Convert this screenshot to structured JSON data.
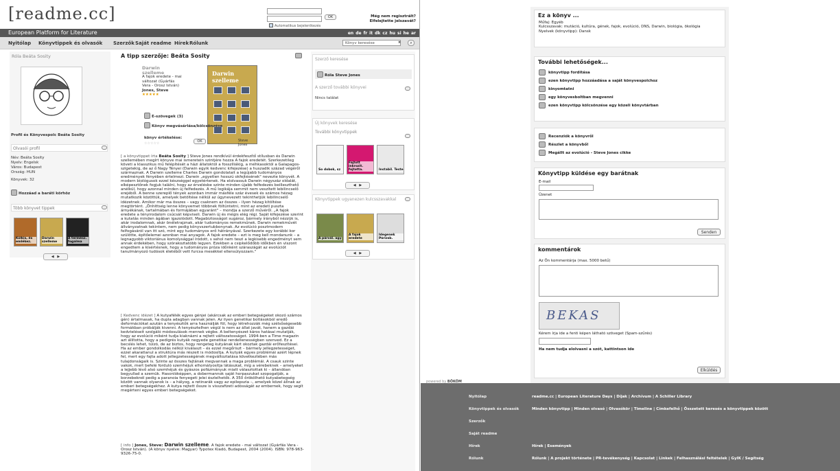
{
  "header": {
    "logo": "[readme.cc]",
    "tagline": "European Platform for Literature",
    "ok": "OK",
    "autologin": "Automatikus bejelentkezés",
    "register": "Még nem regisztrált?",
    "forgot": "Elfelejtette jelszavát?",
    "languages": [
      "en",
      "de",
      "fr",
      "it",
      "dk",
      "cz",
      "hu",
      "si",
      "he",
      "ar"
    ]
  },
  "nav": {
    "items": [
      "Nyitólap",
      "Könyvtippek és olvasók",
      "Szerzők",
      "Saját readme",
      "Hírek",
      "Rólunk"
    ],
    "search_placeholder": "Könyv keresése"
  },
  "left_col": {
    "about": "Róla Beáta Sosity",
    "profile_link": "Profil és Könyvespolc Beáta Sosity",
    "reader_profile": "Olvasói profil",
    "info": [
      "Név: Beáta Sosity",
      "Nyelv: Engelsk",
      "Város: Budapest",
      "Ország: HUN"
    ],
    "books_count": "Könyvek: 32",
    "add_friend": "Hozzáad a baráti körhöz",
    "more_tips": "Több könyvet tippek",
    "thumbs": [
      "Kölkis, és emlékez.",
      "Darwin szelleme",
      "A termész. fogalma"
    ]
  },
  "main": {
    "title": "A tipp szerzője: Beáta Sosity",
    "book_title": "Darwin szelleme",
    "book_sub": "A fajok eredete - mai változat (Gyárfás Vera - Orosz István)",
    "book_author": "Jones, Steve",
    "stars": "★★★★★",
    "ebooks": "E-szövegek (3)",
    "compare": "Könyv megvásárlása/kölcsönzése",
    "rating_label": "könyv értékelése:",
    "rating_stars": "☆☆☆☆☆",
    "cover_title": "Darwin szelleme",
    "cover_author": "Steve Jones",
    "para1_tag": "[ a könyvtippet írta ",
    "para1_author": "Beáta Sosity",
    "para1_rest": " ] Steve Jones rendkívül érdekfeszítő stílusban és Darwin szellemében megírt könyve mai ismeretein szintjére hozza A fajok eredetét. Szerkezetileg követi a klasszikus mű felépítését a házi állatoktól a fosszíliákig, a méhkasoktól a Galapagos-szigetekig, de az ő Nagy Tényei (Darwin egyik kedvenc kifejezése) a huszadik század végéről származnak. A Darwin szelleme Charles Darwin gondolatait a legújabb tudományos eredmények fényében értelmezi. Darwin „egyetlen hosszú okfejtésének\" nevezte könyvét. A modern biológusok ezzel készséggel egyetértenek. Ha elolvassuk Darwin négyszáz oldalát, elképesztőnek fogjuk találni, hogy az érvelésbe szinte minden újabb felfedezés beilleszthető anélkül, hogy azonnal minden új felfedezés. A mű logikája semmit nem veszített lebilincselő erejéből. A benne szereplő tények azonban immár másféle száz évesek és számos hézag mutatkozik közöttük, amelyek betöltése nélkül az úgynevezett tekinthetjük lebilincselő idézetnek. Amikor már ma összes – vagy csaknem az összes – ilyen hézag kitöltése megtörtént. „Önhittség lenne könyvemet többnek föltüntetni, mint az eredeti puszta árnyékának, tartalmában és formájában egyaránt\" – mondja a szerző művéről. „A fajok eredete a tényirodalom csúcsát képviseli. Darwin új és mégis elég régi. Saját kifejezése szerint a kutatás minden ágában igazolódott. Magabiztosságot sugároz, bármely irányból nézzük is, akár irodalomnak, akár önéletrajznak, akár tudományos remekműnek. Darwin remekművét állványzatnak tekintem, nem pedig könyvszertubbonynak. Az evolúció posztmodern felfogásáról van itt szó, mint egy tudományos erő hátrányával. Szerkezete egy korábbi kor szülötte, építőelemei azonban mai anyagok. A fajok eredete – ezt is meg kell mondanunk – a legnagyobb viktoriánus komolysággal íródott, s sehol nem teszi a legkisebb engedményt sem annak érdekében, hogy szórakoztatóbb legyen. Ezekben a csipkelődőbb időkben én viszont engedtem a kísértésnek, hogy a tudományos próza időnként száraszágát az evolúciót tanulmányozó tudósok életéből vett furcsa mesékkel ellensúlyozzam.\"",
    "para2_tag": "[ Kedvenc idézet ]",
    "para2_rest": " A kutyafélék egyes génjei (akárcsak az emberi betegségeket okozó számos gén) ártalmasak, ha dupla adagban vannak jelen. Az ilyen genetikai botlásokból eredő deformációkat azután a tenyésztők arra használják föl, hogy létrehozzák még szélsőségesebb formákban próbálják kivenni. A tenyésztelhen végül is nem az állat javát, hanem a gazdái kedvteléseit szolgáló módosulások mennek végbe. A beltenyészet káros hatásai mutatják, hogy az evolúció miként tudja kiaknázni a rejtett változatosságot. 1994-ben a Time magazin azt állította, hogy a pedigrés kutyák negyede genetikai rendellenességben szenved. Ez a becslés lehet, túlzó, de az biztos, hogy rengeteg kutyának kárt okoztak gazdái erőfeszítései. Ha az ember gondolkodás nélkül kiválaszt – és ezzel megőriszt – bármely jellegzetességet, ezzel akaratlanul a struktúra más részeit is módosítja. A kutyák egyes problémái azért lépnek fel, mert egy fajta adott jellegzetességének megváltoztatása következtében más tulajdonságaik is. Szinte az összes fajtának megvannak a maga problémái. A csauk szinte vakok, mert befelé forduló szemhéjuk elhomályosítja látásukat, míg a vérebeknek – amelyeket a lejjebb lévő alsó szemhéjuk és gyászos pofázmányuk miatt választottak ki – állandóan begyullad a szemük. Hasonlóképpen, a dobermannok saját horpaszukat szopogatják, a borzebeknél pedig a paranoia fenyegeti jelei észlelhetők. A 350 őrökölhető kutyabetegség között vannak olyanok is – a hályog, a retinarák vagy az epilepszia –, amelyek közel állnak az emberi betegségekhez. A kutya rejtett őssze is visszafizeti adósságát az embernek, hogy segít megérteni egyes emberi betegségeket.",
    "para3_tag": "[ info ] ",
    "para3_bold1": "Jones, Steve: ",
    "para3_bold2": "Darwin szelleme",
    "para3_rest": ". A fajok eredete - mai változat (Gyárfás Vera - Orosz István). (A könyv nyelve: Magyar) Typotex Kiadó, Budapest, 2004 (2004). ISBN: 978-963-9326-75-0."
  },
  "right_col": {
    "author_search": "Szerző keresése",
    "about_author": "Róla Steve Jones",
    "more_books": "A szerző további könyvei",
    "no_result": "Nincs találat",
    "new_books": "Új könyvek keresése",
    "more_tips": "További könyvtippek",
    "tips1": [
      "So dobok, sz",
      "Fajtott inkrozit. fojtotta.",
      "Instabil. Teste"
    ],
    "keyword_tips": "Könyvtippek ugyanezen kulcsszavakkal",
    "tips2": [
      "A párvál. agy",
      "A fajok eredete",
      "Idegenek Párizsb."
    ]
  },
  "about_book": {
    "title": "Ez a könyv ...",
    "genre": "Műfaj: Egyéb",
    "keywords": "Kulcsszavak: mutáció, kultúra, gének, fajok, evolúció, DNS, Darwin, biológia, ökológia",
    "language": "Nyelvek (könyvtipp): Dansk"
  },
  "more_options": {
    "title": "További lehetőségek...",
    "links": [
      "könyvtipp fordítása",
      "ezen könyvtipp hozzáadása a saját könyvespolchoz",
      "kinyomtatni",
      "egy könyvesboltban megvenni",
      "ezen könyvtipp kölcsönzése egy közeli könyvtárban"
    ]
  },
  "reviews": {
    "links": [
      "Recenziók a könyvről",
      "Részlet a könyvből",
      "Megállt az evolúció - Steve Jones cikke"
    ]
  },
  "send": {
    "title": "Könyvtipp küldése egy barátnak",
    "email_label": "E-mail",
    "message_label": "Üzenet",
    "send_button": "Senden"
  },
  "comments": {
    "title": "kommentárok",
    "comment_label": "Az Ön kommentárja (max. 5000 betű)",
    "captcha": "BEKAS",
    "captcha_label": "Kérem írja ide a fenti képen látható szöveget (Spam-szűrés)",
    "unknown": "Ha nem tudja elolvasni a szót, kattintson ide",
    "submit": "Elküldés"
  },
  "powered": "powered by",
  "powered_brand": "BÖKÖM",
  "footer": {
    "rows": [
      {
        "label": "Nyitólap",
        "value": "readme.cc | European Literature Days | Díjak | Archívum | A Schiller Library"
      },
      {
        "label": "Könyvtippek és olvasók",
        "value": "Minden könyvtipp | Minden olvasó | Olvasókör | Timeline | Címkefelhő | Összetett keresés a könyvtippek között"
      },
      {
        "label": "Szerzők",
        "value": ""
      },
      {
        "label": "Saját readme",
        "value": ""
      },
      {
        "label": "Hírek",
        "value": "Hírek | Események"
      },
      {
        "label": "Rólunk",
        "value": "Rólunk | A projekt története | PR-tevékenység | Kapcsolat | Linkek | Felhasználási feltételek | GyIK / Segítség"
      }
    ]
  },
  "colors": {
    "header_bar": "#565656",
    "nav_bg": "#e1e1e1",
    "footer_bg": "#6d6d6d",
    "star": "#e8a000"
  }
}
